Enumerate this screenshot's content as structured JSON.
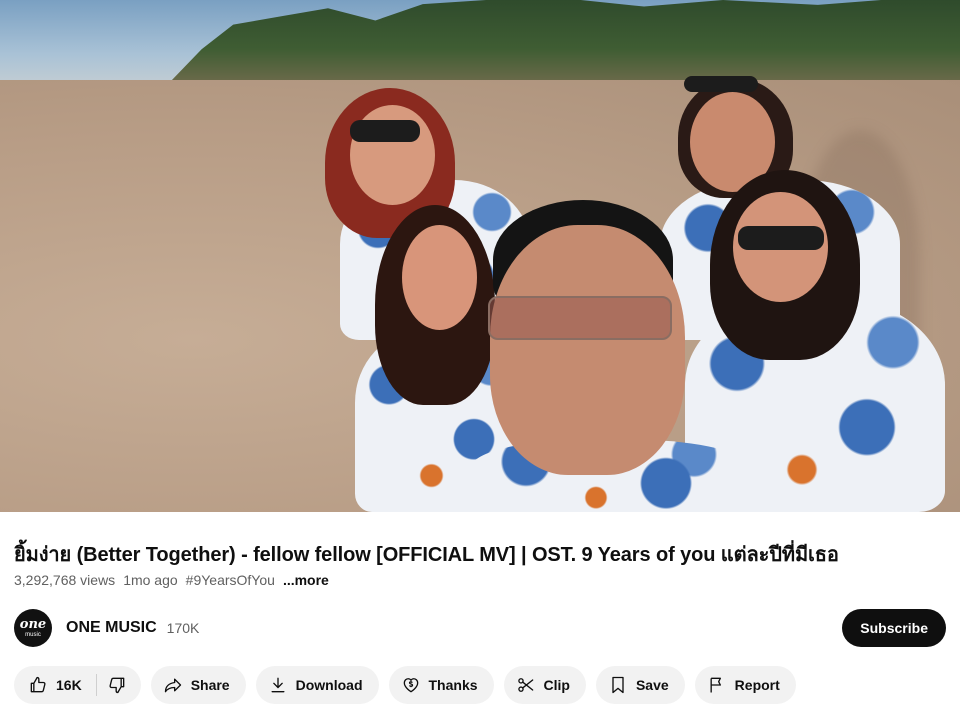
{
  "video": {
    "title": "ยิ้มง่าย (Better Together) - fellow fellow [OFFICIAL MV]  | OST. 9 Years of you แต่ละปีที่มีเธอ",
    "views": "3,292,768 views",
    "age": "1mo ago",
    "hashtag": "#9YearsOfYou",
    "more_label": "...more"
  },
  "channel": {
    "name": "ONE MUSIC",
    "subscribers": "170K",
    "avatar_text_1": "one",
    "avatar_text_2": "music",
    "subscribe_label": "Subscribe"
  },
  "actions": {
    "like_count": "16K",
    "share_label": "Share",
    "download_label": "Download",
    "thanks_label": "Thanks",
    "clip_label": "Clip",
    "save_label": "Save",
    "report_label": "Report"
  },
  "icons": {
    "like": "thumbs-up-icon",
    "dislike": "thumbs-down-icon",
    "share": "share-arrow-icon",
    "download": "download-icon",
    "thanks": "dollar-heart-icon",
    "clip": "scissors-icon",
    "save": "bookmark-icon",
    "report": "flag-icon"
  },
  "colors": {
    "subscribe_bg": "#0f0f0f",
    "pill_bg": "#f2f2f2",
    "meta_text": "#606060"
  }
}
